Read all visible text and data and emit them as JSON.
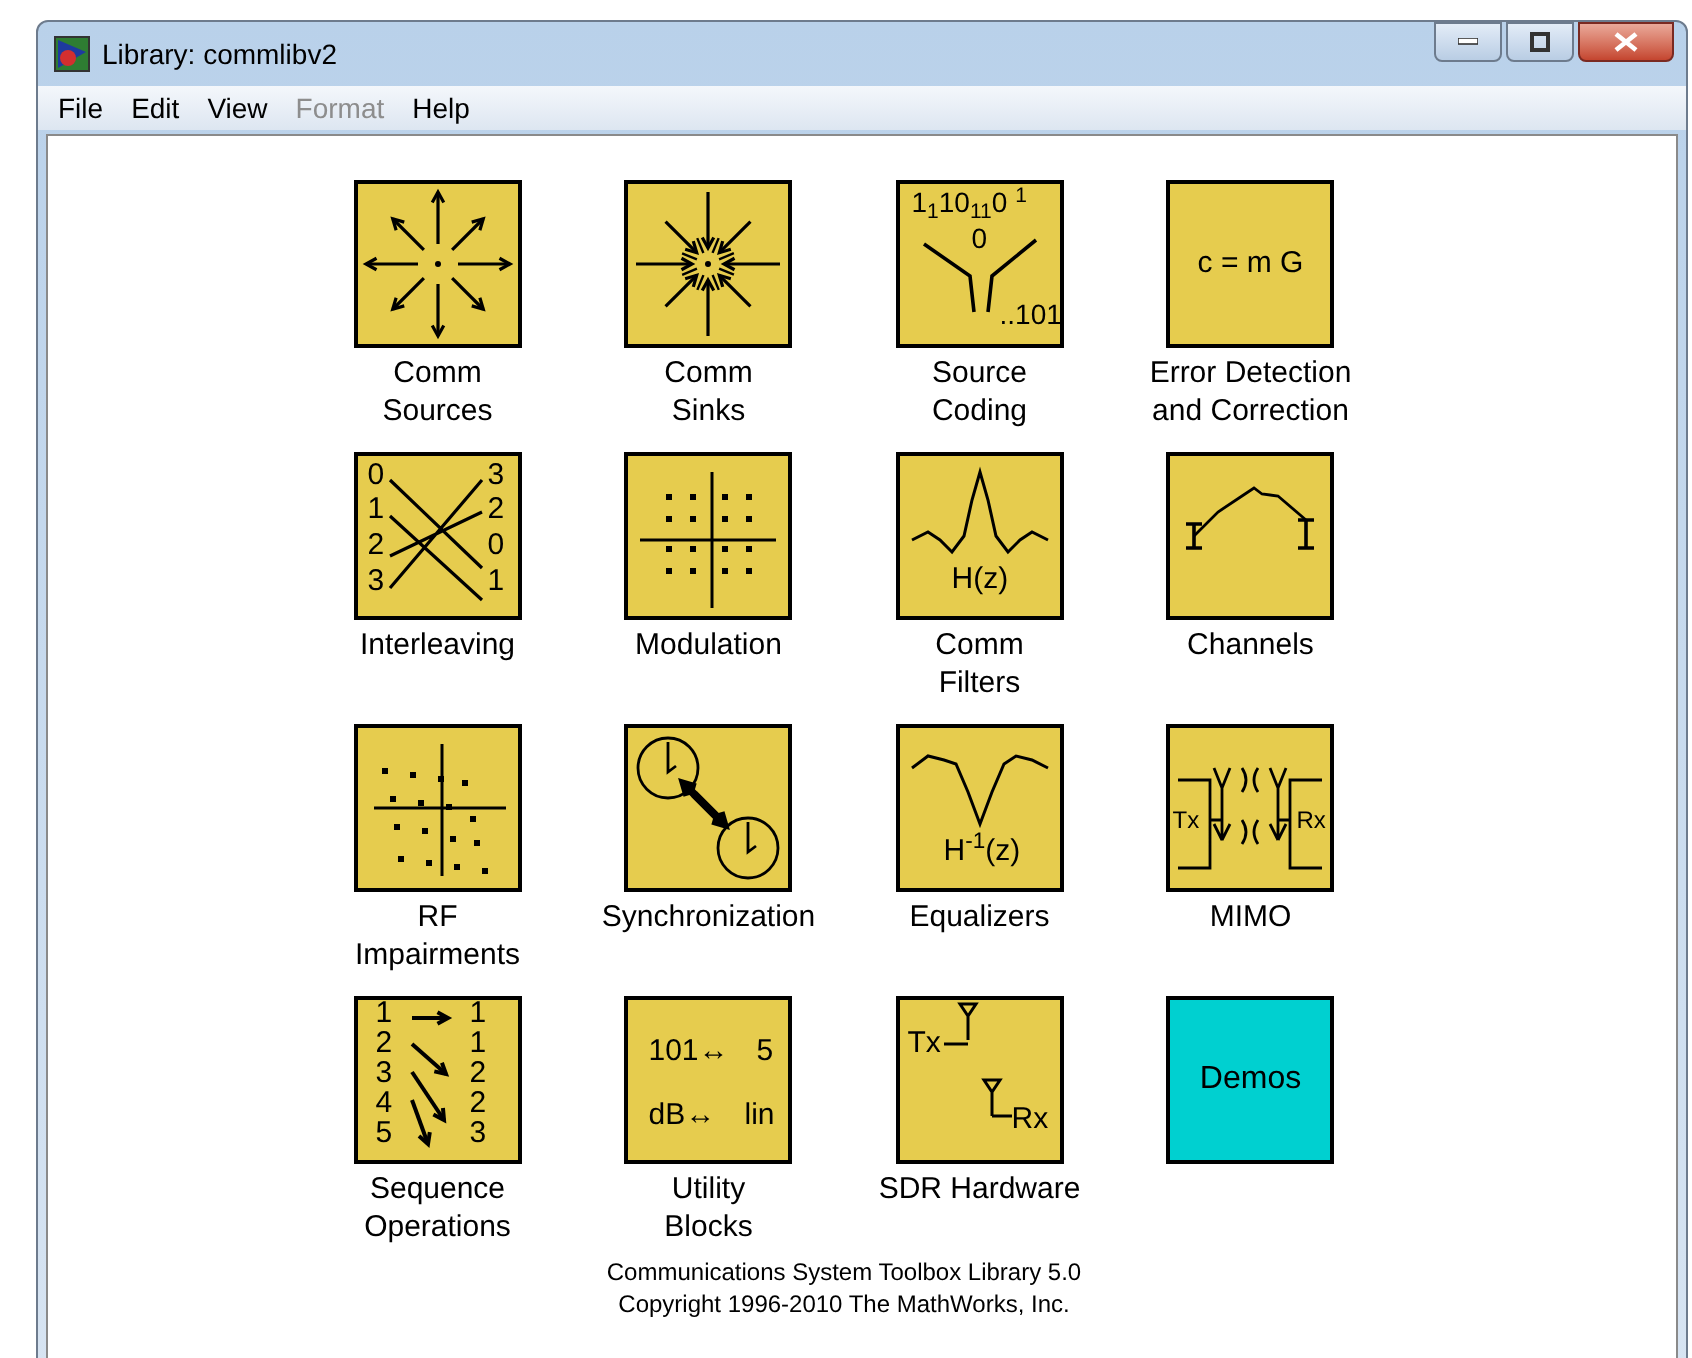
{
  "window": {
    "title": "Library: commlibv2"
  },
  "menu": [
    {
      "label": "File",
      "disabled": false
    },
    {
      "label": "Edit",
      "disabled": false
    },
    {
      "label": "View",
      "disabled": false
    },
    {
      "label": "Format",
      "disabled": true
    },
    {
      "label": "Help",
      "disabled": false
    }
  ],
  "blocks": [
    {
      "kind": "sources",
      "label_lines": [
        "Comm",
        "Sources"
      ]
    },
    {
      "kind": "sinks",
      "label_lines": [
        "Comm",
        "Sinks"
      ]
    },
    {
      "kind": "source_coding",
      "texts": [
        "1$_{1}$10$_{1}$$_{1}$0 $^{1}$",
        "0",
        "..101"
      ],
      "label_lines": [
        "Source",
        "Coding"
      ]
    },
    {
      "kind": "ecc",
      "texts": [
        "c = m G"
      ],
      "label_lines": [
        "Error Detection",
        "and Correction"
      ]
    },
    {
      "kind": "interleaving",
      "texts": [
        "0",
        "1",
        "2",
        "3",
        "3",
        "2",
        "0",
        "1"
      ],
      "label_lines": [
        "Interleaving"
      ]
    },
    {
      "kind": "modulation",
      "label_lines": [
        "Modulation"
      ]
    },
    {
      "kind": "filters",
      "texts": [
        "H(z)"
      ],
      "label_lines": [
        "Comm",
        "Filters"
      ]
    },
    {
      "kind": "channels",
      "label_lines": [
        "Channels"
      ]
    },
    {
      "kind": "rf",
      "label_lines": [
        "RF",
        "Impairments"
      ]
    },
    {
      "kind": "sync",
      "label_lines": [
        "Synchronization"
      ]
    },
    {
      "kind": "equalizers",
      "texts": [
        "H$^{-1}$(z)"
      ],
      "label_lines": [
        "Equalizers"
      ]
    },
    {
      "kind": "mimo",
      "texts": [
        "Tx",
        "Rx"
      ],
      "label_lines": [
        "MIMO"
      ]
    },
    {
      "kind": "sequence",
      "texts": [
        "1",
        "2",
        "3",
        "4",
        "5",
        "1",
        "1",
        "2",
        "2",
        "3"
      ],
      "label_lines": [
        "Sequence",
        "Operations"
      ]
    },
    {
      "kind": "utility",
      "texts": [
        "101↔",
        "5",
        "dB↔",
        "lin"
      ],
      "label_lines": [
        "Utility",
        "Blocks"
      ]
    },
    {
      "kind": "sdr",
      "texts": [
        "Tx",
        "Rx"
      ],
      "label_lines": [
        "SDR Hardware"
      ]
    },
    {
      "kind": "demos",
      "texts": [
        "Demos"
      ]
    }
  ],
  "footer": [
    "Communications System Toolbox Library 5.0",
    "Copyright 1996-2010 The MathWorks, Inc."
  ]
}
